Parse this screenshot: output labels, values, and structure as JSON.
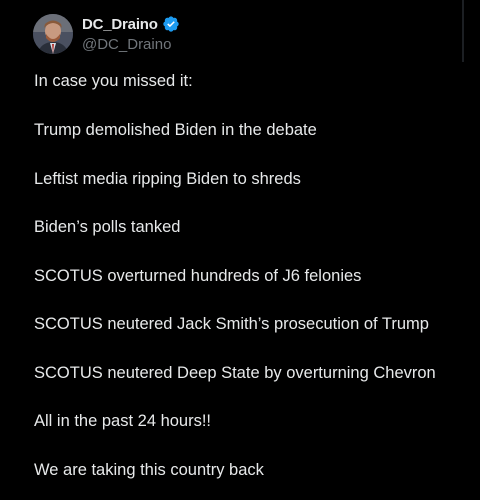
{
  "author": {
    "display_name": "DC_Draino",
    "handle": "@DC_Draino",
    "verified": true
  },
  "colors": {
    "background": "#000000",
    "text": "#e7e9ea",
    "muted": "#71767b",
    "verified_blue": "#1d9bf0"
  },
  "icons": {
    "verified": "verified-badge-icon",
    "avatar": "profile-avatar"
  },
  "tweet": {
    "lines": [
      "In case you missed it:",
      "Trump demolished Biden in the debate",
      "Leftist media ripping Biden to shreds",
      "Biden’s polls tanked",
      "SCOTUS overturned hundreds of J6 felonies",
      "SCOTUS neutered Jack Smith’s prosecution of Trump",
      "SCOTUS neutered Deep State by overturning Chevron",
      "All in the past 24 hours!!",
      "We are taking this country back"
    ]
  }
}
